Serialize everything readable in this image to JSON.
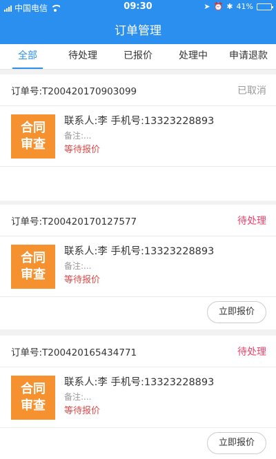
{
  "status_bar": {
    "carrier": "中国电信",
    "time": "09:30",
    "battery": "41%",
    "battery_level": 0.41
  },
  "nav": {
    "title": "订单管理"
  },
  "tabs": [
    {
      "label": "全部",
      "active": true
    },
    {
      "label": "待处理",
      "active": false
    },
    {
      "label": "已报价",
      "active": false
    },
    {
      "label": "处理中",
      "active": false
    },
    {
      "label": "申请退款",
      "active": false
    }
  ],
  "orders": [
    {
      "order_no": "订单号:T200420170903099",
      "status": "已取消",
      "thumb_line1": "合同",
      "thumb_line2": "审查",
      "contact": "联系人:李 手机号:13323228893",
      "remark": "备注:...",
      "quote_state": "等待报价"
    },
    {
      "order_no": "订单号:T200420170127577",
      "status": "待处理",
      "thumb_line1": "合同",
      "thumb_line2": "审查",
      "contact": "联系人:李 手机号:13323228893",
      "remark": "备注:...",
      "quote_state": "等待报价",
      "action": "立即报价"
    },
    {
      "order_no": "订单号:T200420165434771",
      "status": "待处理",
      "thumb_line1": "合同",
      "thumb_line2": "审查",
      "contact": "联系人:李 手机号:13323228893",
      "remark": "备注:...",
      "quote_state": "等待报价",
      "action": "立即报价"
    }
  ],
  "colors": {
    "primary": "#2b8ff0",
    "thumb": "#f5922f",
    "pending": "#e9416b",
    "await": "#e04848",
    "cancelled": "#999999"
  }
}
